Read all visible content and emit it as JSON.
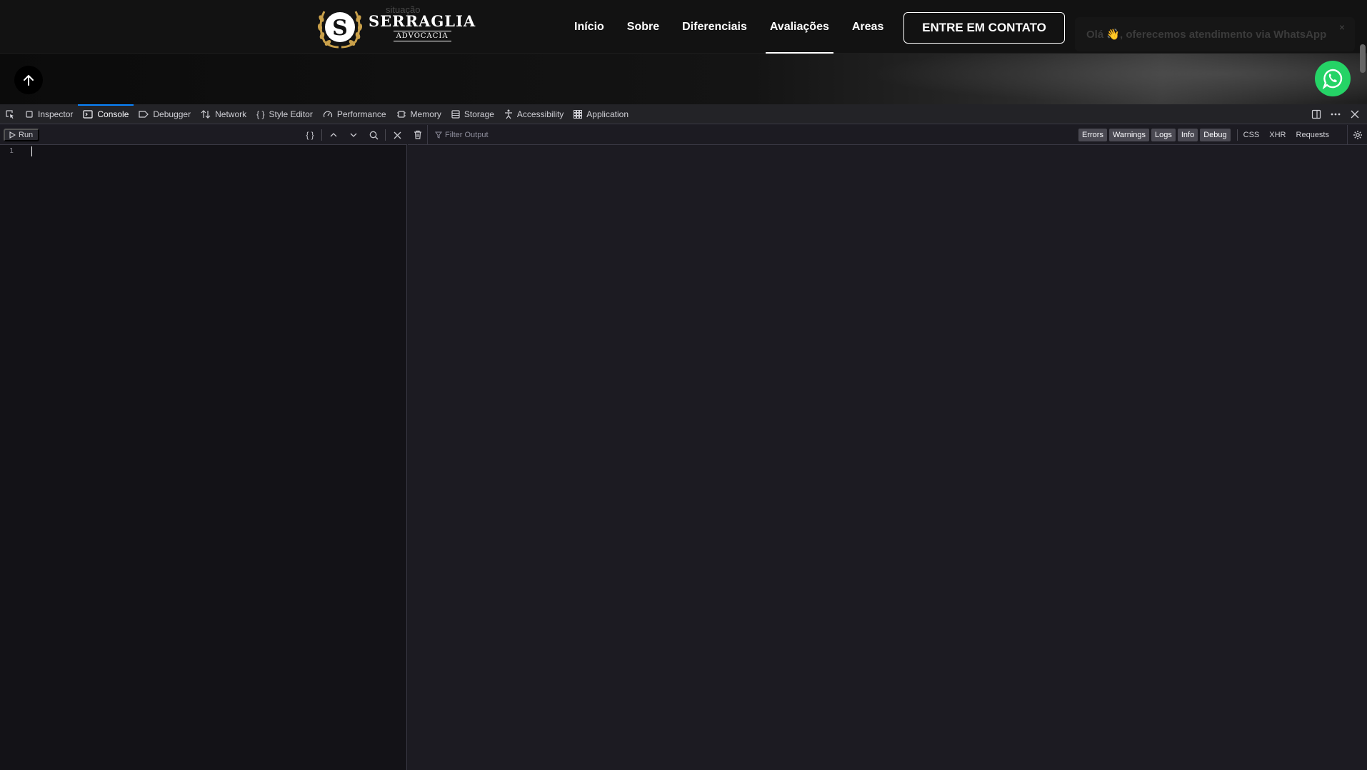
{
  "site": {
    "ghost_text": "situação",
    "logo": {
      "mark_letter": "S",
      "name": "SERRAGLIA",
      "subtitle": "ADVOCACIA"
    },
    "nav": [
      {
        "label": "Início",
        "active": false
      },
      {
        "label": "Sobre",
        "active": false
      },
      {
        "label": "Diferenciais",
        "active": false
      },
      {
        "label": "Avaliações",
        "active": true
      },
      {
        "label": "Areas",
        "active": false
      }
    ],
    "cta_label": "ENTRE EM CONTATO",
    "whatsapp_toast": {
      "text": "Olá 👋, oferecemos atendimento via WhatsApp",
      "close": "×"
    },
    "colors": {
      "whatsapp_green": "#25d366",
      "logo_gold": "#c9a04a"
    }
  },
  "devtools": {
    "tabs": [
      {
        "label": "Inspector",
        "icon": "inspector-icon",
        "selected": false
      },
      {
        "label": "Console",
        "icon": "console-icon",
        "selected": true
      },
      {
        "label": "Debugger",
        "icon": "debugger-icon",
        "selected": false
      },
      {
        "label": "Network",
        "icon": "network-icon",
        "selected": false
      },
      {
        "label": "Style Editor",
        "icon": "style-editor-icon",
        "selected": false
      },
      {
        "label": "Performance",
        "icon": "performance-icon",
        "selected": false
      },
      {
        "label": "Memory",
        "icon": "memory-icon",
        "selected": false
      },
      {
        "label": "Storage",
        "icon": "storage-icon",
        "selected": false
      },
      {
        "label": "Accessibility",
        "icon": "accessibility-icon",
        "selected": false
      },
      {
        "label": "Application",
        "icon": "application-icon",
        "selected": false
      }
    ],
    "editor": {
      "run_label": "Run",
      "pretty_print_label": "{ }",
      "line_numbers": [
        "1"
      ]
    },
    "output": {
      "filter_placeholder": "Filter Output",
      "levels": [
        "Errors",
        "Warnings",
        "Logs",
        "Info",
        "Debug"
      ],
      "extra_filters": [
        "CSS",
        "XHR",
        "Requests"
      ]
    },
    "colors": {
      "accent": "#0a84ff",
      "panel_bg": "#1c1b22",
      "editor_bg": "#131217"
    }
  }
}
